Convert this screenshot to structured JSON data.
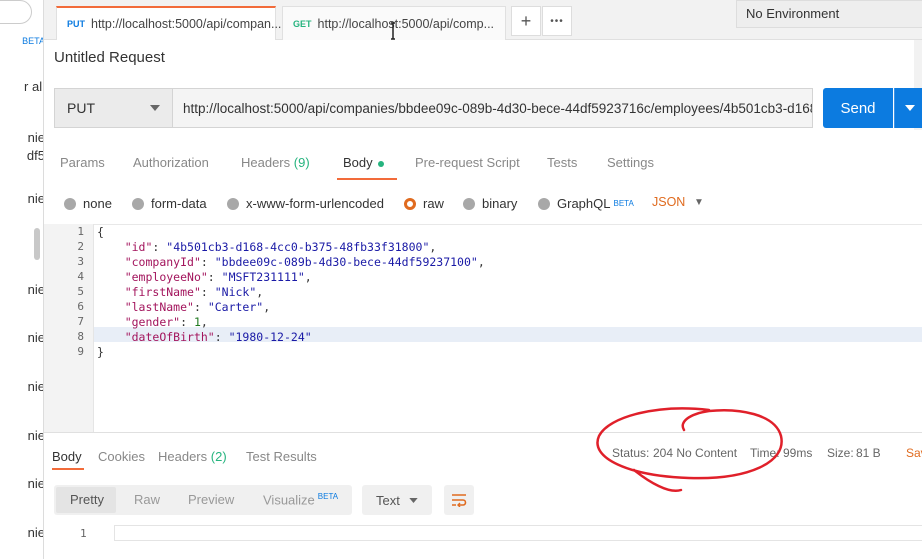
{
  "sidebar": {
    "beta_badge": "BETA",
    "fragments": [
      "r all",
      "nie",
      "df5",
      "nie",
      "nie",
      "nie",
      "nie",
      "nie",
      "nie",
      "nie"
    ]
  },
  "tabs": [
    {
      "method": "PUT",
      "url": "http://localhost:5000/api/compan..."
    },
    {
      "method": "GET",
      "url": "http://localhost:5000/api/comp..."
    }
  ],
  "toolbar": {
    "add": "+",
    "more": "•••"
  },
  "environment": "No Environment",
  "request": {
    "title": "Untitled Request",
    "method": "PUT",
    "url": "http://localhost:5000/api/companies/bbdee09c-089b-4d30-bece-44df5923716c/employees/4b501cb3-d168-...",
    "send_label": "Send"
  },
  "request_tabs": [
    "Params",
    "Authorization",
    "Headers",
    "(9)",
    "Body",
    "Pre-request Script",
    "Tests",
    "Settings"
  ],
  "body_modes": [
    "none",
    "form-data",
    "x-www-form-urlencoded",
    "raw",
    "binary",
    "GraphQL"
  ],
  "beta_label": "BETA",
  "format": "JSON",
  "code_lines": [
    {
      "num": "1",
      "text": "{"
    },
    {
      "num": "2",
      "key": "\"id\"",
      "value": "\"4b501cb3-d168-4cc0-b375-48fb33f31800\"",
      "tail": ","
    },
    {
      "num": "3",
      "key": "\"companyId\"",
      "value": "\"bbdee09c-089b-4d30-bece-44df59237100\"",
      "tail": ","
    },
    {
      "num": "4",
      "key": "\"employeeNo\"",
      "value": "\"MSFT231111\"",
      "tail": ","
    },
    {
      "num": "5",
      "key": "\"firstName\"",
      "value": "\"Nick\"",
      "tail": ","
    },
    {
      "num": "6",
      "key": "\"lastName\"",
      "value": "\"Carter\"",
      "tail": ","
    },
    {
      "num": "7",
      "key": "\"gender\"",
      "value": "1",
      "tail": ","
    },
    {
      "num": "8",
      "key": "\"dateOfBirth\"",
      "value": "\"1980-12-24\"",
      "tail": ""
    },
    {
      "num": "9",
      "text": "}"
    }
  ],
  "response": {
    "tabs": [
      "Body",
      "Cookies",
      "Headers",
      "(2)",
      "Test Results"
    ],
    "status_label": "Status:",
    "status_value": "204 No Content",
    "time_label": "Time:",
    "time_value": "99ms",
    "size_label": "Size:",
    "size_value": "81 B",
    "save_fragment": "Sav",
    "formats": [
      "Pretty",
      "Raw",
      "Preview",
      "Visualize"
    ],
    "visualize_beta": "BETA",
    "text_type": "Text",
    "line_number": "1"
  },
  "colors": {
    "accent": "#f26b3a",
    "send": "#0c7be0",
    "success": "#26b47f",
    "annotation": "#e0202a"
  }
}
